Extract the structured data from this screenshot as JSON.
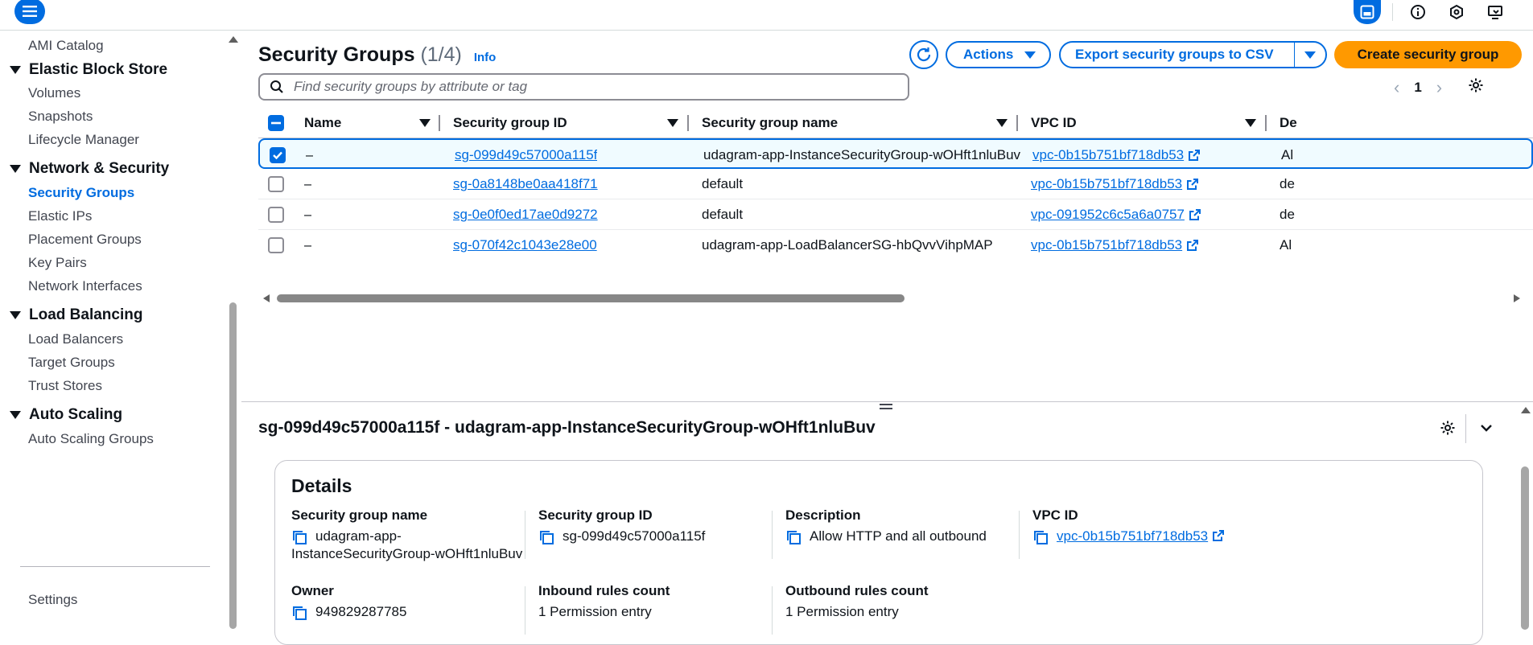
{
  "topbar": {
    "icons": [
      "menu-icon",
      "panel-icon",
      "info-icon",
      "hexagon-icon",
      "display-icon"
    ]
  },
  "sidebar": {
    "items_top": [
      {
        "label": "AMI Catalog"
      }
    ],
    "sections": [
      {
        "title": "Elastic Block Store",
        "items": [
          "Volumes",
          "Snapshots",
          "Lifecycle Manager"
        ]
      },
      {
        "title": "Network & Security",
        "items": [
          "Security Groups",
          "Elastic IPs",
          "Placement Groups",
          "Key Pairs",
          "Network Interfaces"
        ]
      },
      {
        "title": "Load Balancing",
        "items": [
          "Load Balancers",
          "Target Groups",
          "Trust Stores"
        ]
      },
      {
        "title": "Auto Scaling",
        "items": [
          "Auto Scaling Groups"
        ]
      }
    ],
    "active_item": "Security Groups",
    "settings": "Settings"
  },
  "header": {
    "title": "Security Groups",
    "count": "(1/4)",
    "info": "Info",
    "actions": "Actions",
    "export": "Export security groups to CSV",
    "create": "Create security group"
  },
  "search": {
    "placeholder": "Find security groups by attribute or tag"
  },
  "pagination": {
    "page": "1"
  },
  "table": {
    "columns": [
      "Name",
      "Security group ID",
      "Security group name",
      "VPC ID",
      "De"
    ],
    "rows": [
      {
        "name": "–",
        "id": "sg-099d49c57000a115f",
        "sgname": "udagram-app-InstanceSecurityGroup-wOHft1nluBuv",
        "vpc": "vpc-0b15b751bf718db53",
        "desc": "Al",
        "selected": true
      },
      {
        "name": "–",
        "id": "sg-0a8148be0aa418f71",
        "sgname": "default",
        "vpc": "vpc-0b15b751bf718db53",
        "desc": "de",
        "selected": false
      },
      {
        "name": "–",
        "id": "sg-0e0f0ed17ae0d9272",
        "sgname": "default",
        "vpc": "vpc-091952c6c5a6a0757",
        "desc": "de",
        "selected": false
      },
      {
        "name": "–",
        "id": "sg-070f42c1043e28e00",
        "sgname": "udagram-app-LoadBalancerSG-hbQvvVihpMAP",
        "vpc": "vpc-0b15b751bf718db53",
        "desc": "Al",
        "selected": false
      }
    ]
  },
  "detail": {
    "title": "sg-099d49c57000a115f - udagram-app-InstanceSecurityGroup-wOHft1nluBuv",
    "card_title": "Details",
    "fields": {
      "sg_name_label": "Security group name",
      "sg_name_line1": "udagram-app-",
      "sg_name_line2": "InstanceSecurityGroup-wOHft1nluBuv",
      "sg_id_label": "Security group ID",
      "sg_id_value": "sg-099d49c57000a115f",
      "desc_label": "Description",
      "desc_value": "Allow HTTP and all outbound",
      "vpc_label": "VPC ID",
      "vpc_value": "vpc-0b15b751bf718db53",
      "owner_label": "Owner",
      "owner_value": "949829287785",
      "inbound_label": "Inbound rules count",
      "inbound_value": "1 Permission entry",
      "outbound_label": "Outbound rules count",
      "outbound_value": "1 Permission entry"
    }
  },
  "colors": {
    "accent": "#006ce0",
    "primary_button": "#ff9900",
    "text": "#0f141a"
  }
}
